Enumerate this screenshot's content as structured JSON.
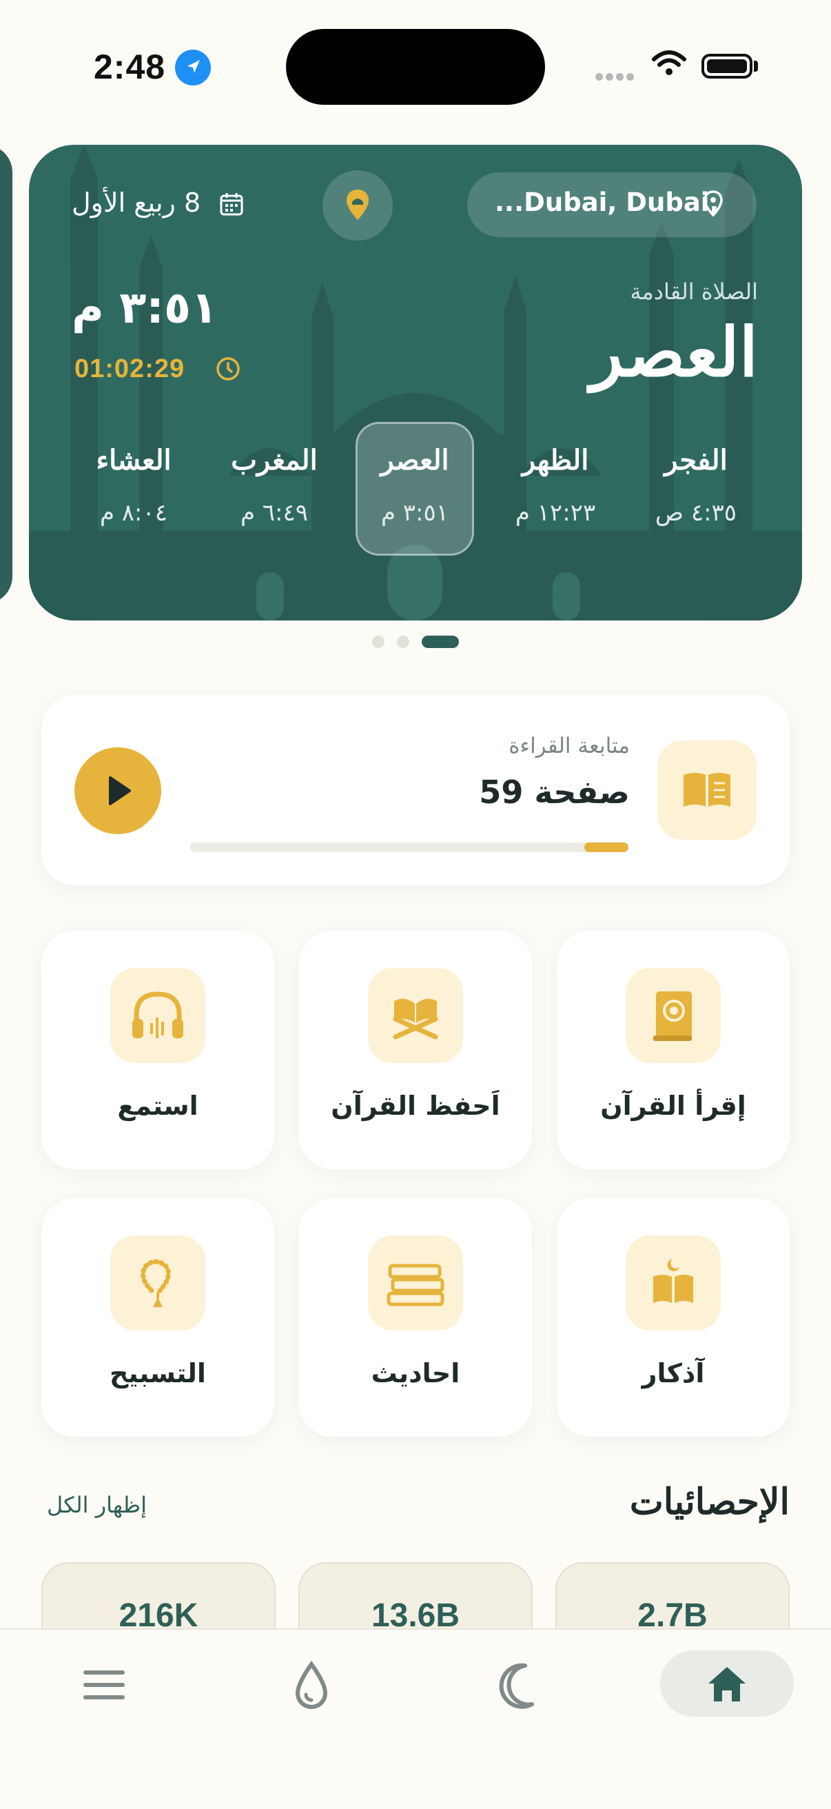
{
  "status_bar": {
    "time": "2:48"
  },
  "prayer_card": {
    "city": "...Dubai, Dubai,",
    "hijri_date": "8 ربيع الأول",
    "next_prayer_label": "الصلاة القادمة",
    "next_prayer_name": "العصر",
    "next_prayer_time": "٣:٥١ م",
    "countdown": "01:02:29",
    "prayers": [
      {
        "name": "الفجر",
        "time": "٤:٣٥ ص"
      },
      {
        "name": "الظهر",
        "time": "١٢:٢٣ م"
      },
      {
        "name": "العصر",
        "time": "٣:٥١ م"
      },
      {
        "name": "المغرب",
        "time": "٦:٤٩ م"
      },
      {
        "name": "العشاء",
        "time": "٨:٠٤ م"
      }
    ],
    "active_prayer_index": 2,
    "page_indicator": {
      "count": 3,
      "active_index": 2
    }
  },
  "continue_reading": {
    "label": "متابعة القراءة",
    "page": "صفحة 59",
    "progress": 0.1
  },
  "features": [
    {
      "label": "إقرأ القرآن",
      "icon": "quran-book-icon"
    },
    {
      "label": "اَحفظ القرآن",
      "icon": "quran-stand-icon"
    },
    {
      "label": "استمع",
      "icon": "headphones-icon"
    },
    {
      "label": "آذكار",
      "icon": "open-book-moon-icon"
    },
    {
      "label": "احاديث",
      "icon": "books-stack-icon"
    },
    {
      "label": "التسبيح",
      "icon": "prayer-beads-icon"
    }
  ],
  "stats": {
    "title": "الإحصائيات",
    "show_all": "إظهار الكل",
    "values": [
      "2.7B",
      "13.6B",
      "216K"
    ]
  },
  "bottom_nav": {
    "items": [
      "home-icon",
      "moon-icon",
      "drop-icon",
      "menu-icon"
    ],
    "active": "home-icon"
  },
  "colors": {
    "primary": "#2e5f58",
    "accent": "#e6b43c",
    "background": "#fcfbf6"
  }
}
